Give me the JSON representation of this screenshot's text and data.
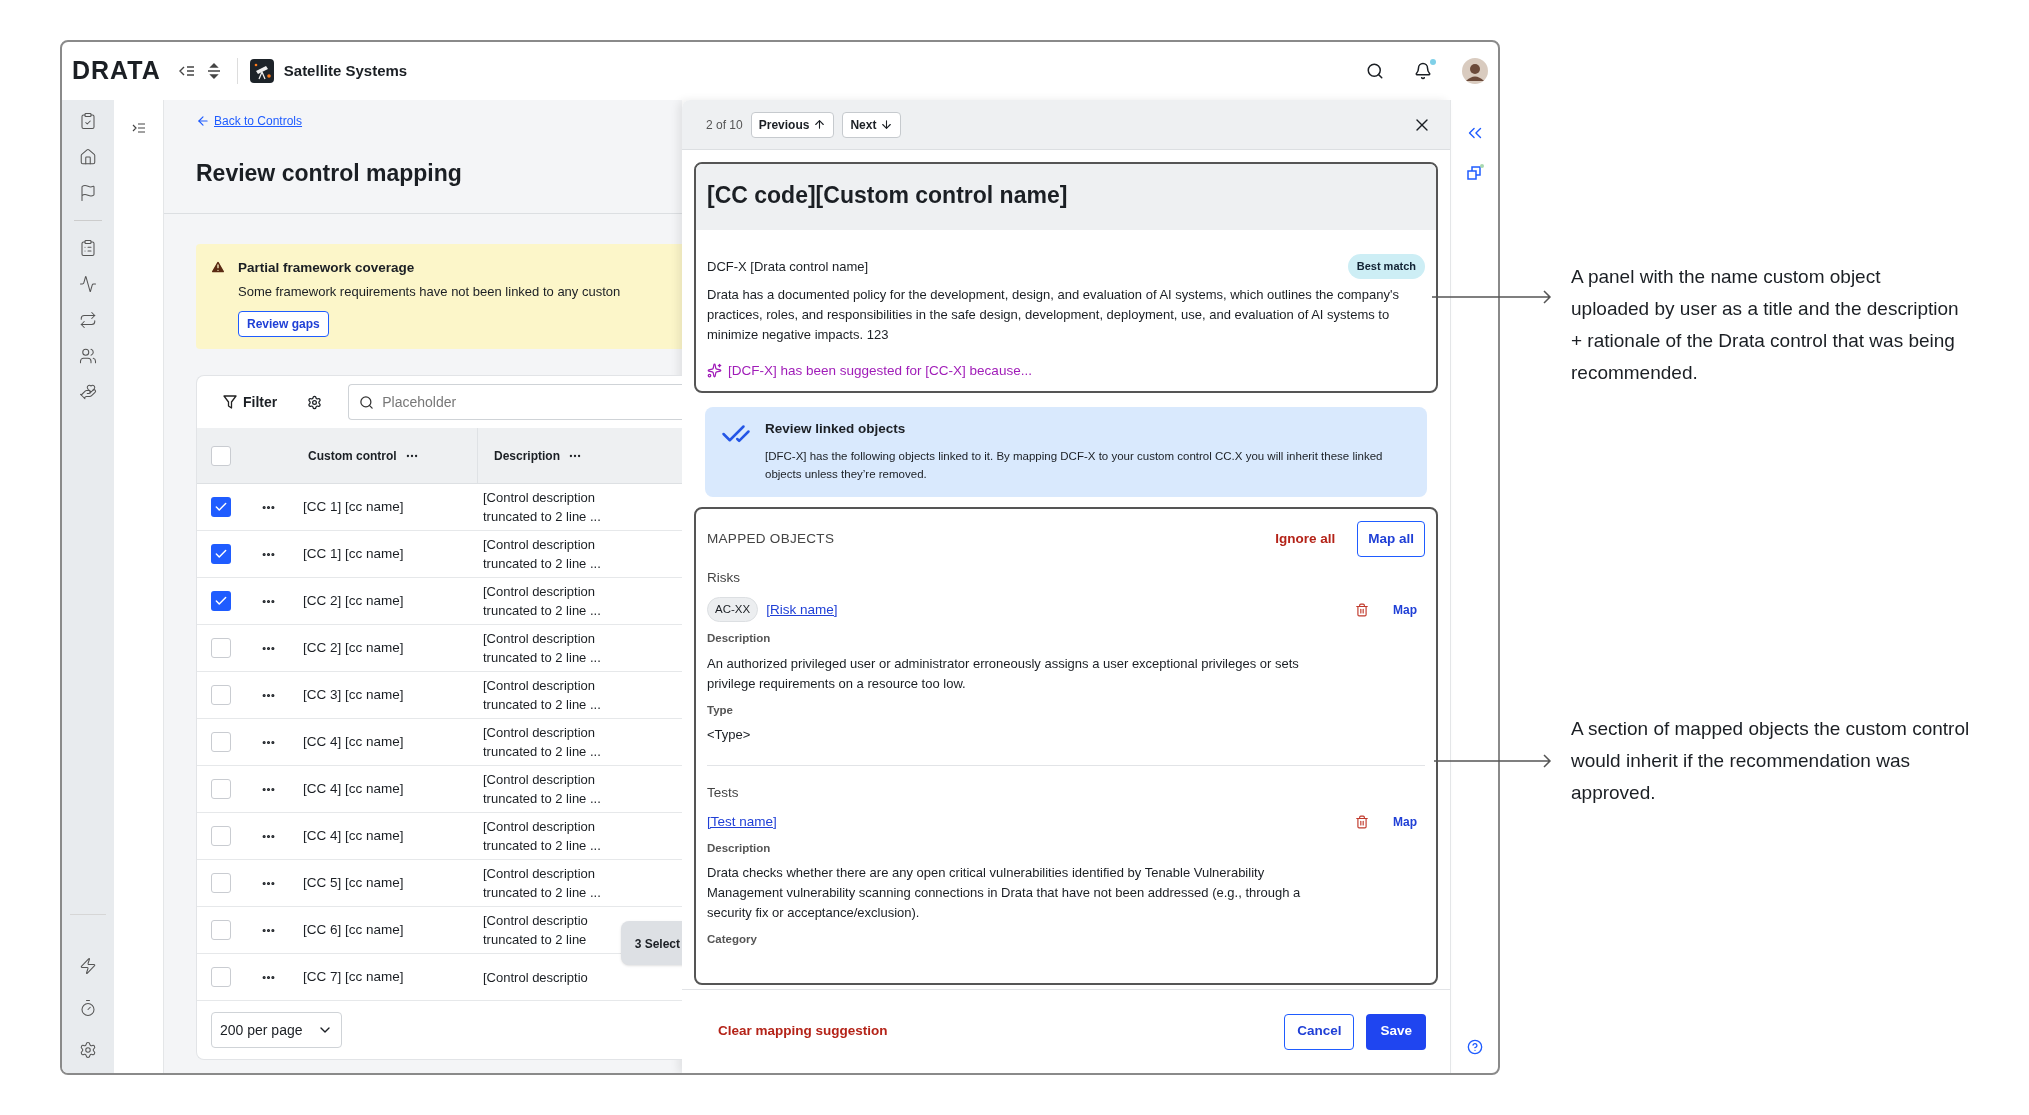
{
  "app": {
    "logo": "DRATA",
    "workspace": "Satellite Systems"
  },
  "page": {
    "back_link": "Back to Controls",
    "title": "Review control mapping"
  },
  "banner": {
    "title": "Partial framework coverage",
    "message": "Some framework requirements have not been linked to any custon",
    "button": "Review gaps"
  },
  "table": {
    "filter": "Filter",
    "search_placeholder": "Placeholder",
    "columns": [
      "Custom control",
      "Description"
    ],
    "header_checked": false,
    "rows": [
      {
        "checked": true,
        "name": "[CC 1] [cc name]",
        "description": "[Control description truncated to 2 line ..."
      },
      {
        "checked": true,
        "name": "[CC 1] [cc name]",
        "description": "[Control description truncated to 2 line ..."
      },
      {
        "checked": true,
        "name": "[CC 2] [cc name]",
        "description": "[Control description truncated to 2 line ..."
      },
      {
        "checked": false,
        "name": "[CC 2] [cc name]",
        "description": "[Control description truncated to 2 line ..."
      },
      {
        "checked": false,
        "name": "[CC 3] [cc name]",
        "description": "[Control description truncated to 2 line ..."
      },
      {
        "checked": false,
        "name": "[CC 4] [cc name]",
        "description": "[Control description truncated to 2 line ..."
      },
      {
        "checked": false,
        "name": "[CC 4] [cc name]",
        "description": "[Control description truncated to 2 line ..."
      },
      {
        "checked": false,
        "name": "[CC 4] [cc name]",
        "description": "[Control description truncated to 2 line ..."
      },
      {
        "checked": false,
        "name": "[CC 5] [cc name]",
        "description": "[Control description truncated to 2 line ..."
      },
      {
        "checked": false,
        "name": "[CC 6] [cc name]",
        "description": "[Control descriptio truncated to 2 line"
      },
      {
        "checked": false,
        "name": "[CC 7] [cc name]",
        "description": "[Control descriptio"
      }
    ],
    "page_size": "200 per page",
    "selection": "3 Select"
  },
  "drawer": {
    "position": "2 of 10",
    "previous": "Previous",
    "next": "Next",
    "title": "[CC code][Custom control name]",
    "control_name": "DCF-X [Drata control name]",
    "badge": "Best match",
    "description": "Drata has a documented policy for the development, design, and evaluation of AI systems, which outlines the company's practices, roles, and responsibilities in the safe design, development, deployment, use, and evaluation of AI systems to minimize negative impacts. 123",
    "suggestion": "[DCF-X] has been suggested for [CC-X] because...",
    "notice": {
      "title": "Review linked objects",
      "text": "[DFC-X] has the following objects linked to it. By mapping DCF-X to your custom control CC.X you will inherit these linked objects unless they’re removed."
    },
    "mapped": {
      "heading": "MAPPED OBJECTS",
      "ignore_all": "Ignore all",
      "map_all": "Map all",
      "groups": [
        {
          "title": "Risks",
          "tag": "AC-XX",
          "name": "[Risk name]",
          "map": "Map",
          "fields": [
            {
              "label": "Description",
              "value": "An authorized privileged user or administrator erroneously assigns a user exceptional privileges or sets privilege requirements on a resource too low."
            },
            {
              "label": "Type",
              "value": "<Type>"
            }
          ]
        },
        {
          "title": "Tests",
          "name": "[Test name]",
          "map": "Map",
          "fields": [
            {
              "label": "Description",
              "value": "Drata checks whether there are any open critical vulnerabilities identified by Tenable Vulnerability Management vulnerability scanning connections in Drata that have not been addressed (e.g., through a security fix or acceptance/exclusion)."
            },
            {
              "label": "Category"
            }
          ]
        }
      ]
    },
    "footer": {
      "clear": "Clear mapping suggestion",
      "cancel": "Cancel",
      "save": "Save"
    }
  },
  "annotations": [
    "A panel with the name custom object uploaded by user as a title and the description + rationale of the Drata control that was being recommended.",
    "A section of mapped objects the custom control would inherit if the recommendation was approved."
  ]
}
